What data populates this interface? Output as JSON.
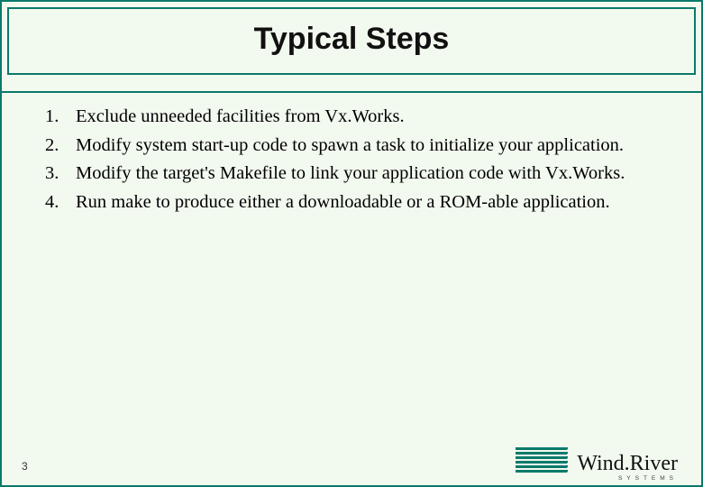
{
  "title": "Typical Steps",
  "steps": {
    "s1": "Exclude unneeded facilities from Vx.Works.",
    "s2": "Modify system start-up code to spawn a task to initialize your application.",
    "s3": "Modify the target's Makefile to link your application code with Vx.Works.",
    "s4": "Run make to produce either a downloadable or a ROM-able application."
  },
  "page_number": "3",
  "logo": {
    "text": "Wind.River",
    "sub": "SYSTEMS"
  }
}
